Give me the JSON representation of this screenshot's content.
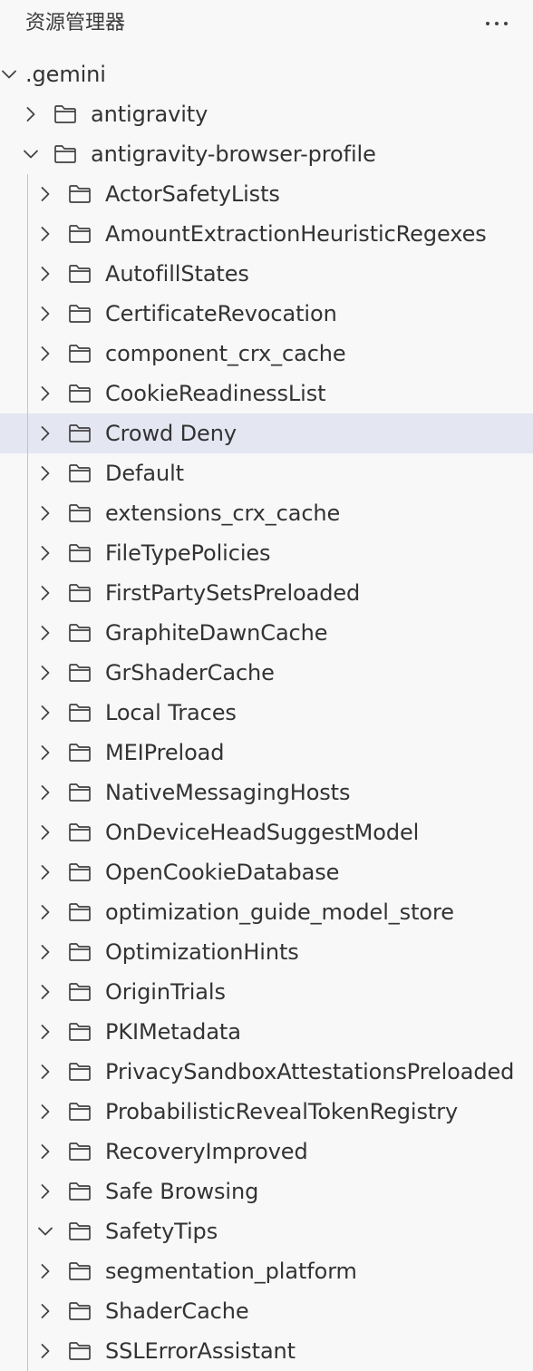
{
  "panel": {
    "title": "资源管理器",
    "more_icon": "ellipsis-icon"
  },
  "tree": [
    {
      "label": ".gemini",
      "depth": 0,
      "expanded": true,
      "folder": false
    },
    {
      "label": "antigravity",
      "depth": 1,
      "expanded": false,
      "folder": true
    },
    {
      "label": "antigravity-browser-profile",
      "depth": 1,
      "expanded": true,
      "folder": true
    },
    {
      "label": "ActorSafetyLists",
      "depth": 2,
      "expanded": false,
      "folder": true
    },
    {
      "label": "AmountExtractionHeuristicRegexes",
      "depth": 2,
      "expanded": false,
      "folder": true
    },
    {
      "label": "AutofillStates",
      "depth": 2,
      "expanded": false,
      "folder": true
    },
    {
      "label": "CertificateRevocation",
      "depth": 2,
      "expanded": false,
      "folder": true
    },
    {
      "label": "component_crx_cache",
      "depth": 2,
      "expanded": false,
      "folder": true
    },
    {
      "label": "CookieReadinessList",
      "depth": 2,
      "expanded": false,
      "folder": true
    },
    {
      "label": "Crowd Deny",
      "depth": 2,
      "expanded": false,
      "folder": true,
      "highlighted": true
    },
    {
      "label": "Default",
      "depth": 2,
      "expanded": false,
      "folder": true
    },
    {
      "label": "extensions_crx_cache",
      "depth": 2,
      "expanded": false,
      "folder": true
    },
    {
      "label": "FileTypePolicies",
      "depth": 2,
      "expanded": false,
      "folder": true
    },
    {
      "label": "FirstPartySetsPreloaded",
      "depth": 2,
      "expanded": false,
      "folder": true
    },
    {
      "label": "GraphiteDawnCache",
      "depth": 2,
      "expanded": false,
      "folder": true
    },
    {
      "label": "GrShaderCache",
      "depth": 2,
      "expanded": false,
      "folder": true
    },
    {
      "label": "Local Traces",
      "depth": 2,
      "expanded": false,
      "folder": true
    },
    {
      "label": "MEIPreload",
      "depth": 2,
      "expanded": false,
      "folder": true
    },
    {
      "label": "NativeMessagingHosts",
      "depth": 2,
      "expanded": false,
      "folder": true
    },
    {
      "label": "OnDeviceHeadSuggestModel",
      "depth": 2,
      "expanded": false,
      "folder": true
    },
    {
      "label": "OpenCookieDatabase",
      "depth": 2,
      "expanded": false,
      "folder": true
    },
    {
      "label": "optimization_guide_model_store",
      "depth": 2,
      "expanded": false,
      "folder": true
    },
    {
      "label": "OptimizationHints",
      "depth": 2,
      "expanded": false,
      "folder": true
    },
    {
      "label": "OriginTrials",
      "depth": 2,
      "expanded": false,
      "folder": true
    },
    {
      "label": "PKIMetadata",
      "depth": 2,
      "expanded": false,
      "folder": true
    },
    {
      "label": "PrivacySandboxAttestationsPreloaded",
      "depth": 2,
      "expanded": false,
      "folder": true
    },
    {
      "label": "ProbabilisticRevealTokenRegistry",
      "depth": 2,
      "expanded": false,
      "folder": true
    },
    {
      "label": "RecoveryImproved",
      "depth": 2,
      "expanded": false,
      "folder": true
    },
    {
      "label": "Safe Browsing",
      "depth": 2,
      "expanded": false,
      "folder": true
    },
    {
      "label": "SafetyTips",
      "depth": 2,
      "expanded": true,
      "folder": true
    },
    {
      "label": "segmentation_platform",
      "depth": 2,
      "expanded": false,
      "folder": true
    },
    {
      "label": "ShaderCache",
      "depth": 2,
      "expanded": false,
      "folder": true
    },
    {
      "label": "SSLErrorAssistant",
      "depth": 2,
      "expanded": false,
      "folder": true
    }
  ],
  "colors": {
    "background": "#f8f8f8",
    "highlight": "#e4e6f1",
    "text": "#333333",
    "icon": "#424242",
    "indent_guide": "#c4c4c4"
  }
}
